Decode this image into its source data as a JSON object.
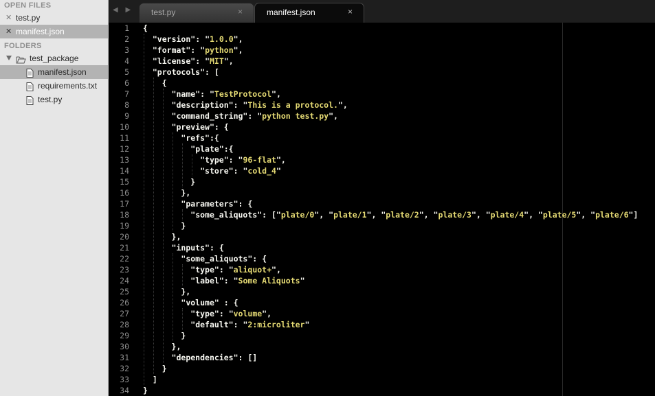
{
  "sidebar": {
    "open_files_header": "OPEN FILES",
    "folders_header": "FOLDERS",
    "open_files": [
      {
        "label": "test.py",
        "selected": false
      },
      {
        "label": "manifest.json",
        "selected": true
      }
    ],
    "folder": {
      "label": "test_package",
      "files": [
        {
          "label": "manifest.json",
          "selected": true
        },
        {
          "label": "requirements.txt",
          "selected": false
        },
        {
          "label": "test.py",
          "selected": false
        }
      ]
    }
  },
  "tabs": [
    {
      "label": "test.py",
      "close": "×",
      "active": false
    },
    {
      "label": "manifest.json",
      "close": "×",
      "active": true
    }
  ],
  "nav_arrows": "◀ ▶",
  "colors": {
    "editor_bg": "#000000",
    "string": "#e6db74",
    "punctuation": "#f8f8f2",
    "line_number": "#8f8f8f",
    "sidebar_bg": "#e6e6e6",
    "sidebar_selected": "#b3b3b3"
  },
  "editor": {
    "lines": [
      "{",
      "  \"version\": \"1.0.0\",",
      "  \"format\": \"python\",",
      "  \"license\": \"MIT\",",
      "  \"protocols\": [",
      "    {",
      "      \"name\": \"TestProtocol\",",
      "      \"description\": \"This is a protocol.\",",
      "      \"command_string\": \"python test.py\",",
      "      \"preview\": {",
      "        \"refs\":{",
      "          \"plate\":{",
      "            \"type\": \"96-flat\",",
      "            \"store\": \"cold_4\"",
      "          }",
      "        },",
      "        \"parameters\": {",
      "          \"some_aliquots\": [\"plate/0\", \"plate/1\", \"plate/2\", \"plate/3\", \"plate/4\", \"plate/5\", \"plate/6\"]",
      "        }",
      "      },",
      "      \"inputs\": {",
      "        \"some_aliquots\": {",
      "          \"type\": \"aliquot+\",",
      "          \"label\": \"Some Aliquots\"",
      "        },",
      "        \"volume\" : {",
      "          \"type\": \"volume\",",
      "          \"default\": \"2:microliter\"",
      "        }",
      "      },",
      "      \"dependencies\": []",
      "    }",
      "  ]",
      "}"
    ]
  }
}
